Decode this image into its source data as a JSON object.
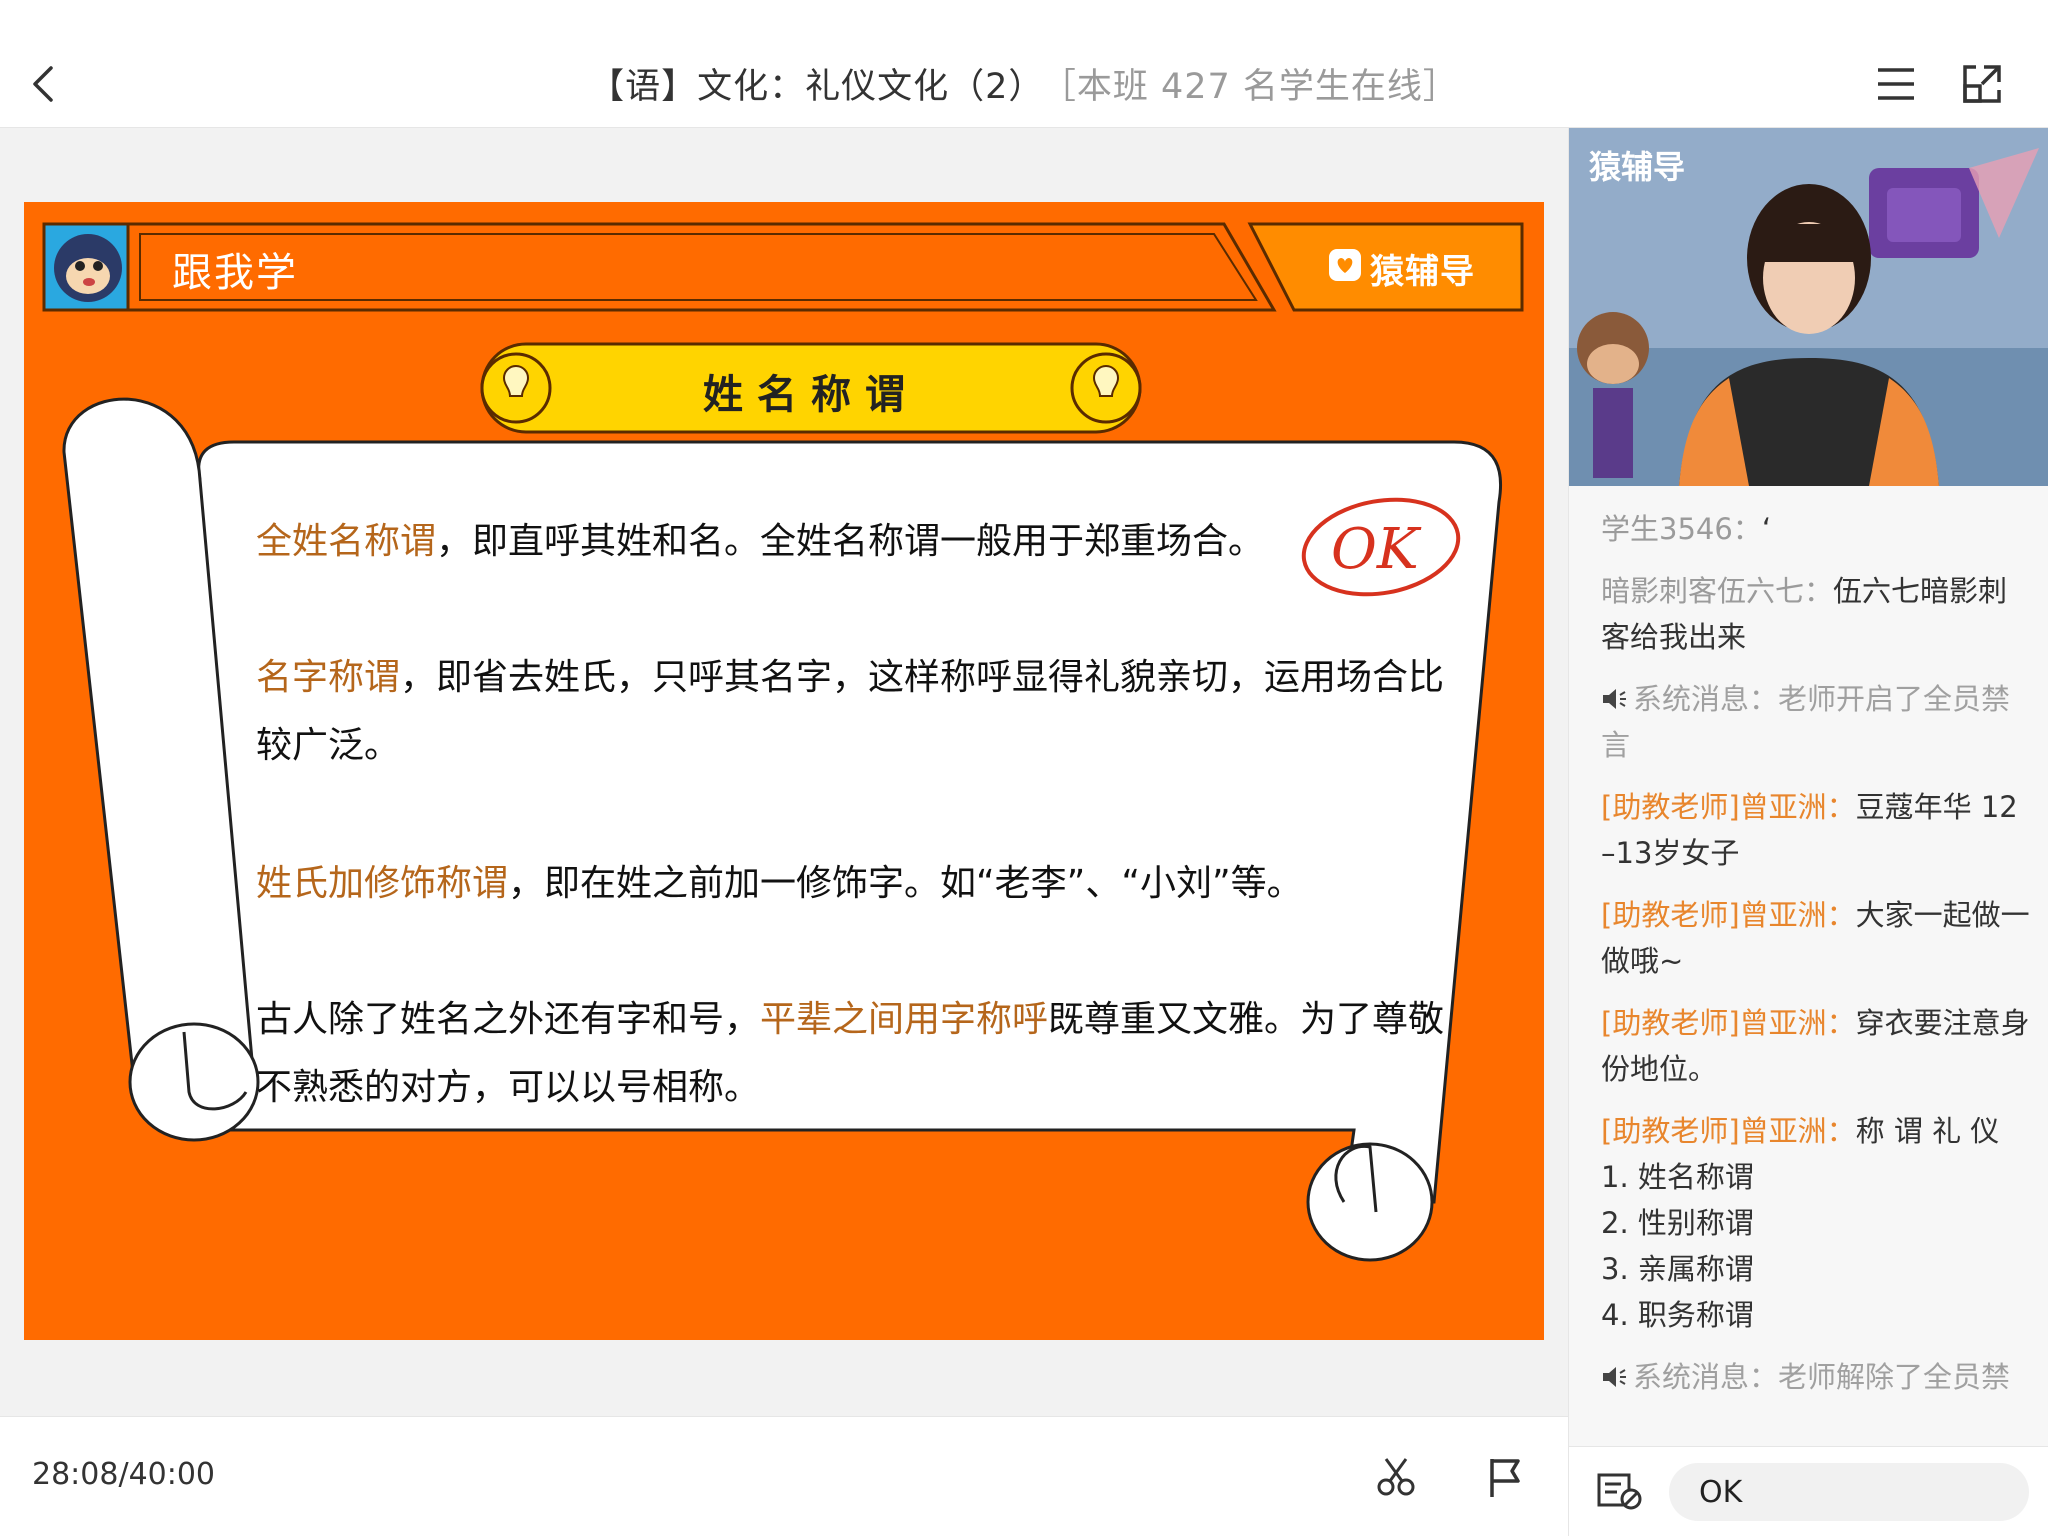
{
  "header": {
    "title": "【语】文化：礼仪文化（2）",
    "online": "［本班 427 名学生在线］"
  },
  "slide": {
    "banner_title": "跟我学",
    "brand": "猿辅导",
    "topic": "姓名称谓",
    "paragraphs": [
      {
        "highlight": "全姓名称谓",
        "text": "，即直呼其姓和名。全姓名称谓一般用于郑重场合。"
      },
      {
        "highlight": "名字称谓",
        "text": "，即省去姓氏，只呼其名字，这样称呼显得礼貌亲切，运用场合比较广泛。"
      },
      {
        "highlight": "姓氏加修饰称谓",
        "text": "，即在姓之前加一修饰字。如“老李”、“小刘”等。"
      },
      {
        "before": "古人除了姓名之外还有字和号，",
        "highlight": "平辈之间用字称呼",
        "text": "既尊重又文雅。为了尊敬不熟悉的对方，可以以号相称。"
      }
    ],
    "annotation": "OK"
  },
  "footer": {
    "time": "28:08/40:00"
  },
  "video": {
    "brand": "猿辅导"
  },
  "chat": {
    "messages": [
      {
        "sender": "学生3546：",
        "text": "‘",
        "kind": "student"
      },
      {
        "sender": "暗影刺客伍六七：",
        "text": "伍六七暗影刺客给我出来",
        "kind": "student"
      },
      {
        "sender": "系统消息：",
        "text": "老师开启了全员禁言",
        "kind": "system"
      },
      {
        "sender": "[助教老师]曾亚洲：",
        "text": "豆蔻年华 12–13岁女子",
        "kind": "ta"
      },
      {
        "sender": "[助教老师]曾亚洲：",
        "text": "大家一起做一做哦~",
        "kind": "ta"
      },
      {
        "sender": "[助教老师]曾亚洲：",
        "text": "穿衣要注意身份地位。",
        "kind": "ta"
      },
      {
        "sender": "[助教老师]曾亚洲：",
        "text": "称 谓 礼 仪",
        "kind": "ta",
        "lines": [
          "1. 姓名称谓",
          "2. 性别称谓",
          "3. 亲属称谓",
          "4. 职务称谓"
        ]
      },
      {
        "sender": "系统消息：",
        "text": "老师解除了全员禁言",
        "kind": "system"
      }
    ],
    "input_value": "OK"
  }
}
